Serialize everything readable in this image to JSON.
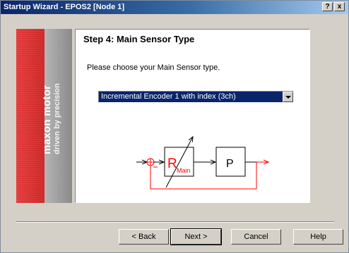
{
  "window": {
    "title": "Startup Wizard - EPOS2 [Node 1]",
    "help_glyph": "?",
    "close_glyph": "x"
  },
  "branding": {
    "primary": "maxon motor",
    "secondary": "driven by precision",
    "accent_color": "#d42a2a"
  },
  "step": {
    "title": "Step 4: Main Sensor Type",
    "prompt": "Please choose your Main Sensor type.",
    "sensor_select": {
      "selected": "Incremental Encoder 1 with index (3ch)"
    }
  },
  "diagram": {
    "regulator_label": "R",
    "regulator_subscript": "Main",
    "plant_label": "P",
    "feedback_color": "#ff0000"
  },
  "buttons": {
    "back": "< Back",
    "next": "Next >",
    "cancel": "Cancel",
    "help": "Help"
  }
}
